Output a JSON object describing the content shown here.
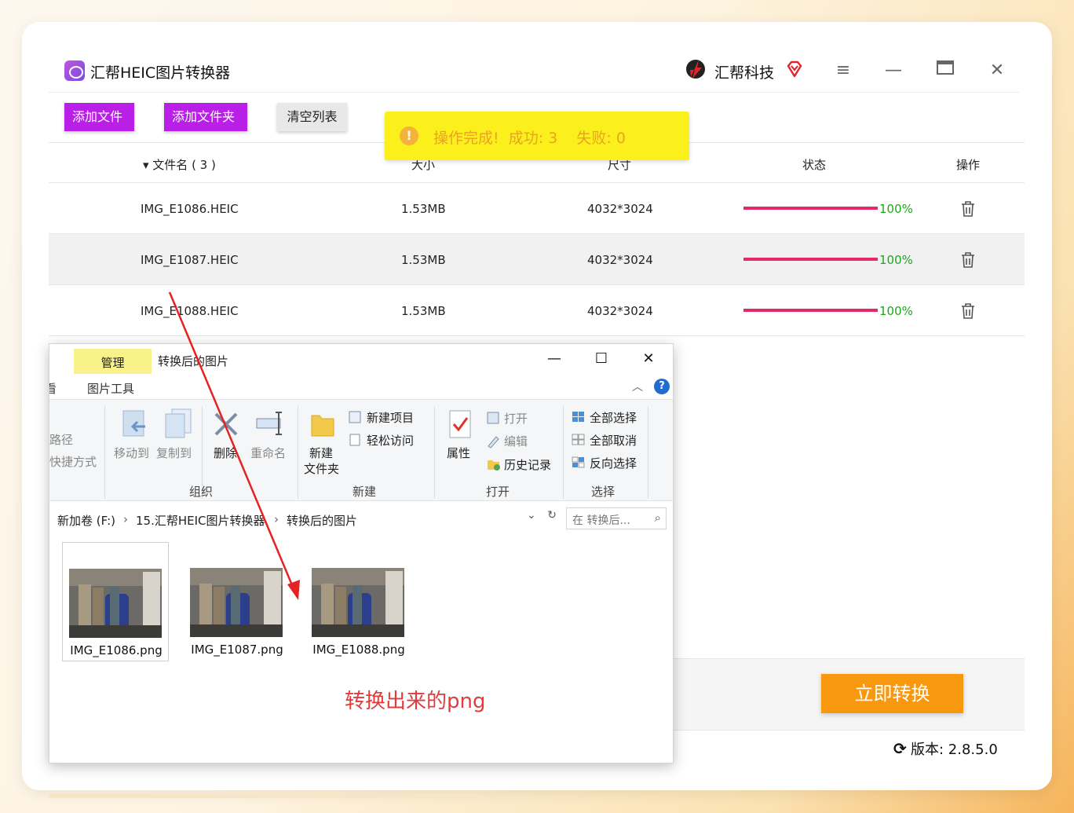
{
  "app": {
    "title": "汇帮HEIC图片转换器",
    "brand": "汇帮科技",
    "accent": "#b91fe6"
  },
  "toolbar": {
    "add_file": "添加文件",
    "add_folder": "添加文件夹",
    "clear_list": "清空列表"
  },
  "table": {
    "headers": {
      "name": "▾ 文件名 ( 3 )",
      "size": "大小",
      "dimensions": "尺寸",
      "status": "状态",
      "action": "操作"
    },
    "rows": [
      {
        "name": "IMG_E1086.HEIC",
        "size": "1.53MB",
        "dimensions": "4032*3024",
        "progress": 1.0,
        "progress_label": "100%"
      },
      {
        "name": "IMG_E1087.HEIC",
        "size": "1.53MB",
        "dimensions": "4032*3024",
        "progress": 1.0,
        "progress_label": "100%"
      },
      {
        "name": "IMG_E1088.HEIC",
        "size": "1.53MB",
        "dimensions": "4032*3024",
        "progress": 1.0,
        "progress_label": "100%"
      }
    ]
  },
  "toast": {
    "icon": "info-icon",
    "text": "操作完成!  成功: 3    失败: 0",
    "color": "#fbf01b"
  },
  "footer": {
    "convert_button": "立即转换",
    "version_label": "版本: ",
    "version": "2.8.5.0"
  },
  "explorer": {
    "tab_manage": "管理",
    "title": "转换后的图片",
    "tab_view": "看",
    "tab_picture_tools": "图片工具",
    "ribbon": {
      "path": "路径",
      "shortcut": "快捷方式",
      "move_to": "移动到",
      "copy_to": "复制到",
      "delete": "删除",
      "rename": "重命名",
      "new_folder_1": "新建",
      "new_folder_2": "文件夹",
      "new_item": "新建项目",
      "easy_access": "轻松访问",
      "properties": "属性",
      "open": "打开",
      "edit": "编辑",
      "history": "历史记录",
      "select_all": "全部选择",
      "select_none": "全部取消",
      "invert_selection": "反向选择",
      "group_organize": "组织",
      "group_new": "新建",
      "group_open": "打开",
      "group_select": "选择"
    },
    "breadcrumb": [
      "新加卷 (F:)",
      "15.汇帮HEIC图片转换器",
      "转换后的图片"
    ],
    "search_placeholder": "在 转换后...",
    "files": [
      "IMG_E1086.png",
      "IMG_E1087.png",
      "IMG_E1088.png"
    ],
    "caption": "转换出来的png"
  }
}
